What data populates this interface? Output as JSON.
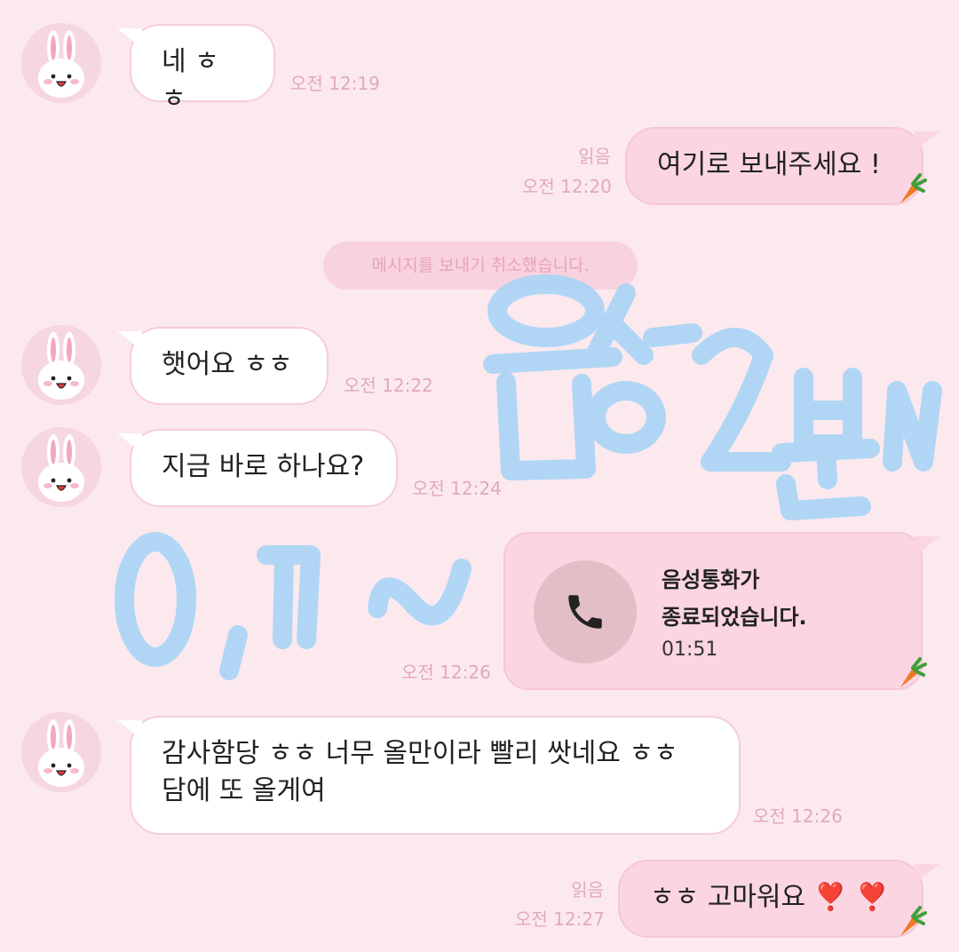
{
  "messages": [
    {
      "text": "네 ㅎㅎ",
      "time": "오전 12:19"
    },
    {
      "text": "여기로 보내주세요 !",
      "time": "오전 12:20",
      "read": "읽음"
    },
    {
      "text": "햇어요 ㅎㅎ",
      "time": "오전 12:22"
    },
    {
      "text": "지금 바로 하나요?",
      "time": "오전 12:24"
    },
    {
      "text": "감사함당 ㅎㅎ 너무 올만이라 빨리 쌋네요 ㅎㅎ",
      "text2": "담에 또 올게여",
      "time": "오전 12:26"
    },
    {
      "text": "ㅎㅎ 고마워요",
      "emoji": "❣️ ❣️",
      "time": "오전 12:27",
      "read": "읽음"
    }
  ],
  "system_notice": "메시지를 보내기 취소했습니다.",
  "call": {
    "line1": "음성통화가",
    "line2": "종료되었습니다.",
    "duration": "01:51",
    "time": "오전 12:26",
    "icon": "phone-icon"
  },
  "overlay": {
    "handwriting": "음성2분~",
    "handwriting2": "ㅇ,ㄱ~"
  },
  "colors": {
    "background": "#fbe9ee",
    "incoming_bubble": "#ffffff",
    "outgoing_bubble": "#fbd6e2",
    "timestamp": "#e3a8c0",
    "overlay_scribble": "#a9d4f6"
  }
}
